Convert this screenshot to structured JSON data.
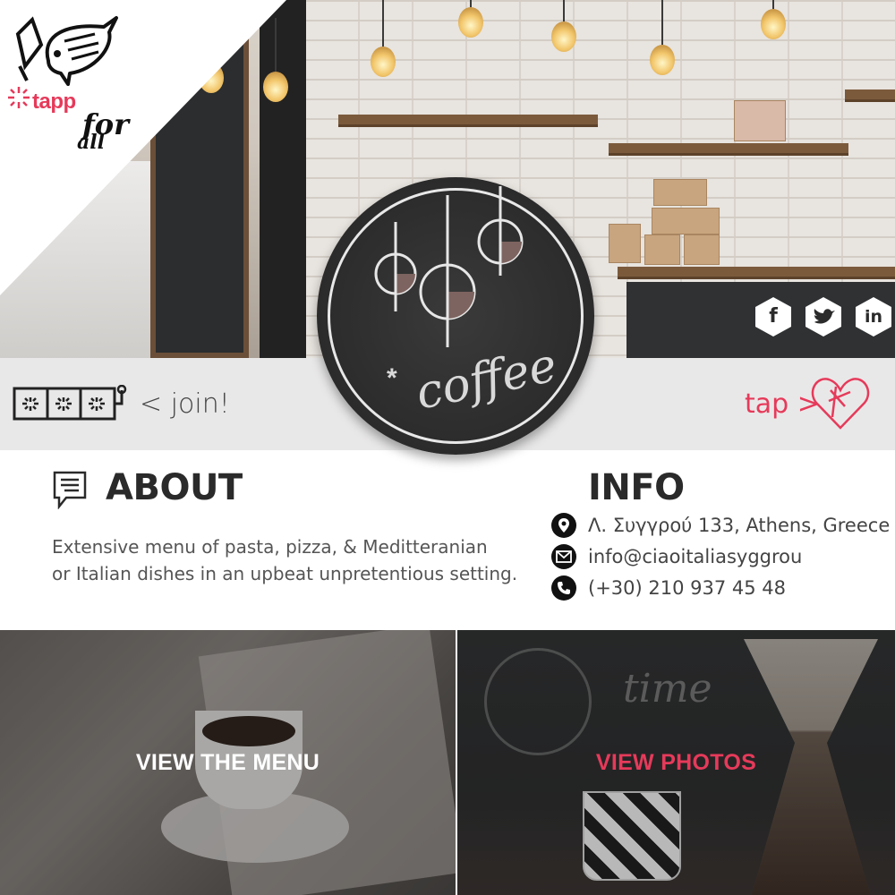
{
  "brand": {
    "logo_line1": "tapp",
    "logo_line2": "for",
    "logo_line3": "all"
  },
  "hero": {
    "badge_text": "coffee",
    "badge_star": "*"
  },
  "social": [
    {
      "name": "facebook",
      "glyph": "f"
    },
    {
      "name": "twitter",
      "glyph": "t"
    },
    {
      "name": "linkedin",
      "glyph": "in"
    }
  ],
  "joinbar": {
    "join_label": "< join!",
    "tap_label": "tap >"
  },
  "about": {
    "title": "ABOUT",
    "text_line1": "Extensive menu of pasta, pizza, & Meditteranian",
    "text_line2": "or Italian dishes in an upbeat unpretentious setting."
  },
  "info": {
    "title": "INFO",
    "address": "Λ. Συγγρού 133, Athens, Greece",
    "email": "info@ciaoitaliasyggrou",
    "phone": "(+30) 210 937 45 48"
  },
  "panels": {
    "menu_label": "VIEW THE MENU",
    "photos_label": "VIEW PHOTOS"
  },
  "colors": {
    "accent": "#e63a5a",
    "dark": "#2a2a2a",
    "bar": "#e9e8e8"
  }
}
